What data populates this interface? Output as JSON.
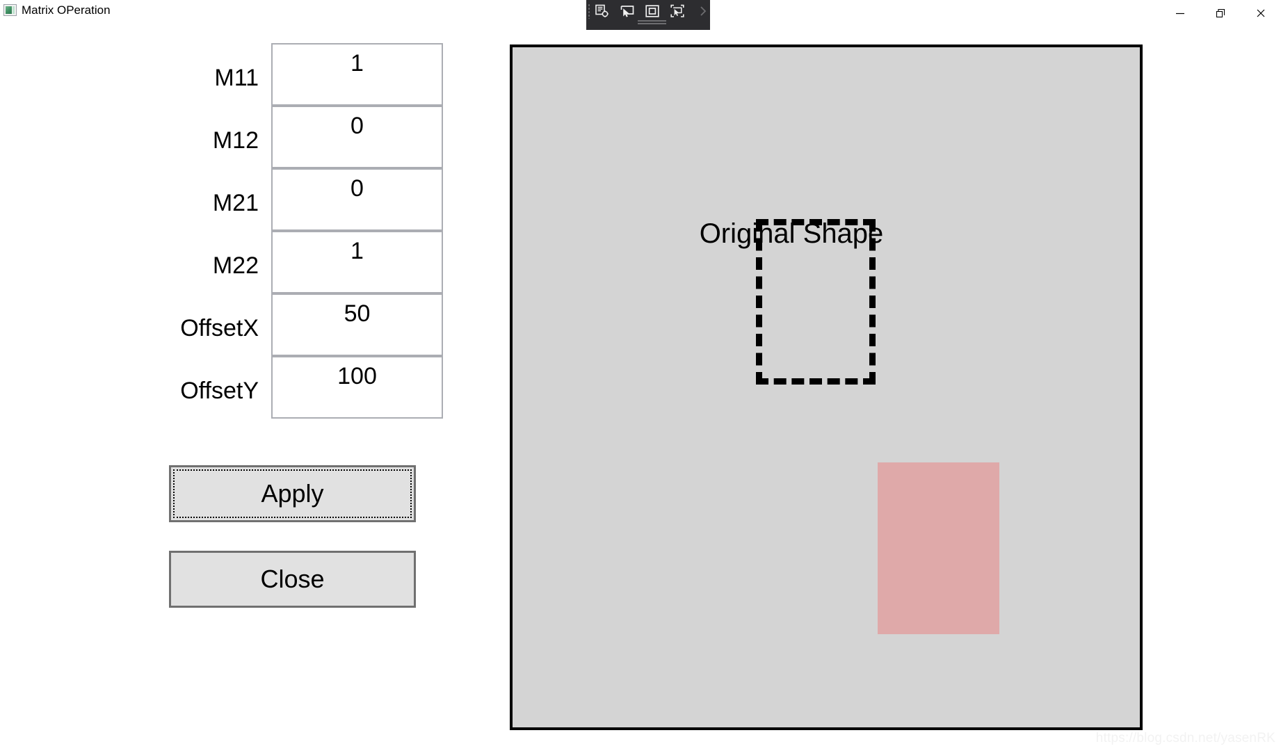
{
  "window": {
    "title": "Matrix OPeration",
    "icon": "app-image-icon",
    "controls": {
      "minimize": "minimize-icon",
      "restore": "restore-icon",
      "close": "close-icon"
    }
  },
  "vs_toolbar": {
    "buttons": [
      {
        "name": "go-to-live-visual-tree-icon",
        "tooltip": "Go to Live Visual Tree"
      },
      {
        "name": "select-element-icon",
        "tooltip": "Enable selection"
      },
      {
        "name": "display-layout-adorners-icon",
        "tooltip": "Display layout adorners"
      },
      {
        "name": "track-focused-element-icon",
        "tooltip": "Track focused element"
      }
    ],
    "expand": "chevron-right-icon"
  },
  "form": {
    "fields": [
      {
        "label": "M11",
        "value": "1"
      },
      {
        "label": "M12",
        "value": "0"
      },
      {
        "label": "M21",
        "value": "0"
      },
      {
        "label": "M22",
        "value": "1"
      },
      {
        "label": "OffsetX",
        "value": "50"
      },
      {
        "label": "OffsetY",
        "value": "100"
      }
    ],
    "buttons": {
      "apply": "Apply",
      "close": "Close"
    }
  },
  "canvas": {
    "background_color": "#d4d4d4",
    "border_color": "#000000",
    "label": "Original Shape",
    "shapes": [
      {
        "name": "original-shape-outline",
        "style": "dashed",
        "stroke_color": "#000000",
        "fill": "none"
      },
      {
        "name": "transformed-shape",
        "style": "filled",
        "fill_color": "#dfa9a9"
      }
    ]
  },
  "watermark": {
    "text": "https://blog.csdn.net/yasenRK"
  }
}
